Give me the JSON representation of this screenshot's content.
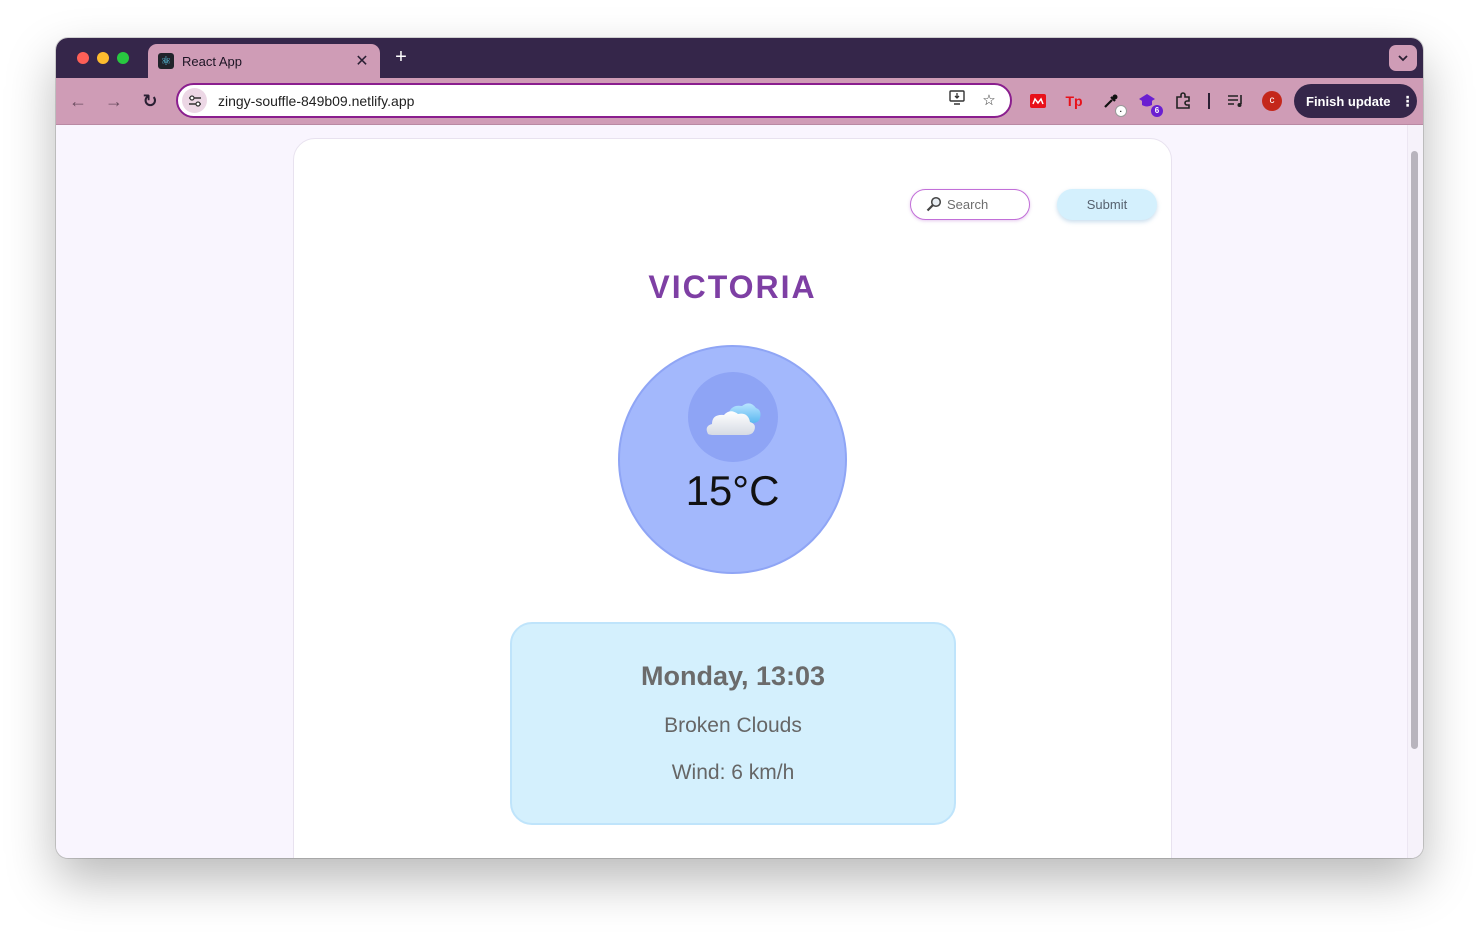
{
  "browser": {
    "tab_title": "React App",
    "tab_close": "✕",
    "new_tab": "+",
    "url": "zingy-souffle-849b09.netlify.app",
    "finish_update_label": "Finish update",
    "avatar_letter": "c",
    "extensions": [
      {
        "name": "red-extension",
        "glyph": "▦",
        "color": "#e8111a"
      },
      {
        "name": "tp-extension",
        "glyph": "Tp",
        "color": "#e8111a"
      },
      {
        "name": "eyedropper-extension",
        "glyph": "✎",
        "color": "#111111"
      },
      {
        "name": "purple-extension",
        "glyph": "◆",
        "color": "#6a1fd1",
        "badge": "6"
      }
    ]
  },
  "app": {
    "search_placeholder": "Search",
    "submit_label": "Submit",
    "city": "VICTORIA",
    "temperature": "15°C",
    "day_time": "Monday, 13:03",
    "description": "Broken Clouds",
    "wind": "Wind: 6 km/h"
  },
  "colors": {
    "accent_purple": "#7e3fa4",
    "circle_blue": "#a3b8fc",
    "panel_blue": "#d4f0fd",
    "toolbar_pink": "#cf9cb6",
    "tabbar_dark": "#35264a"
  }
}
